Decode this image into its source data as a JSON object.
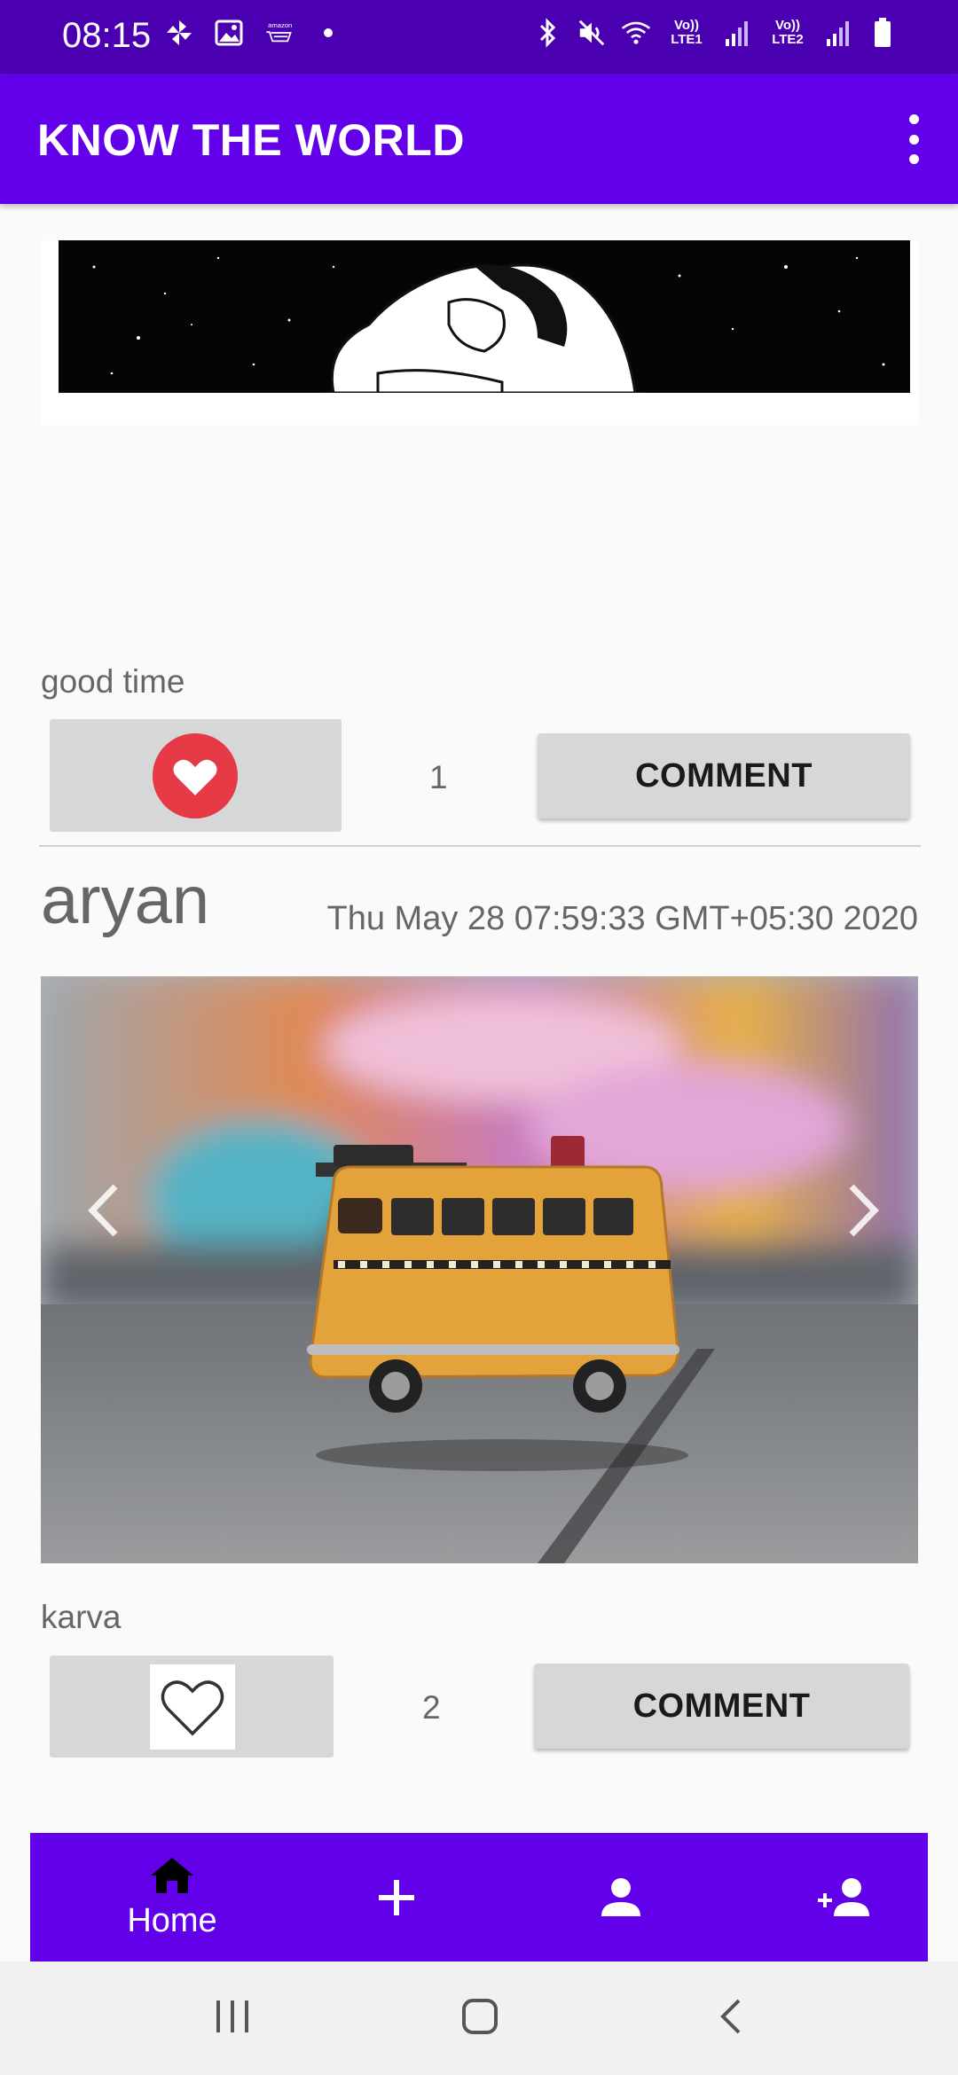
{
  "status_bar": {
    "time": "08:15",
    "left_icons": [
      "pinwheel-icon",
      "gallery-icon",
      "amazon-icon",
      "dot-icon"
    ],
    "right_icons": [
      "bluetooth-icon",
      "mute-icon",
      "wifi-icon",
      "lte1-signal",
      "lte2-signal",
      "battery-icon"
    ],
    "lte1_label": "Vo)) LTE1",
    "lte2_label": "Vo)) LTE2"
  },
  "app_bar": {
    "title": "KNOW THE WORLD",
    "menu_icon": "more-vert-icon"
  },
  "posts": [
    {
      "caption": "good time",
      "liked": true,
      "like_count": "1",
      "comment_label": "COMMENT"
    },
    {
      "author": "aryan",
      "date": "Thu May 28 07:59:33 GMT+05:30 2020",
      "caption": "karva",
      "liked": false,
      "like_count": "2",
      "comment_label": "COMMENT"
    }
  ],
  "bottom_nav": {
    "items": [
      {
        "icon": "home-icon",
        "label": "Home"
      },
      {
        "icon": "add-icon",
        "label": ""
      },
      {
        "icon": "person-icon",
        "label": ""
      },
      {
        "icon": "person-add-icon",
        "label": ""
      }
    ],
    "active_index": 0
  },
  "colors": {
    "status_bar": "#4a00b0",
    "primary": "#6200ea",
    "like_red": "#e53945",
    "button_gray": "#d6d7d7"
  }
}
